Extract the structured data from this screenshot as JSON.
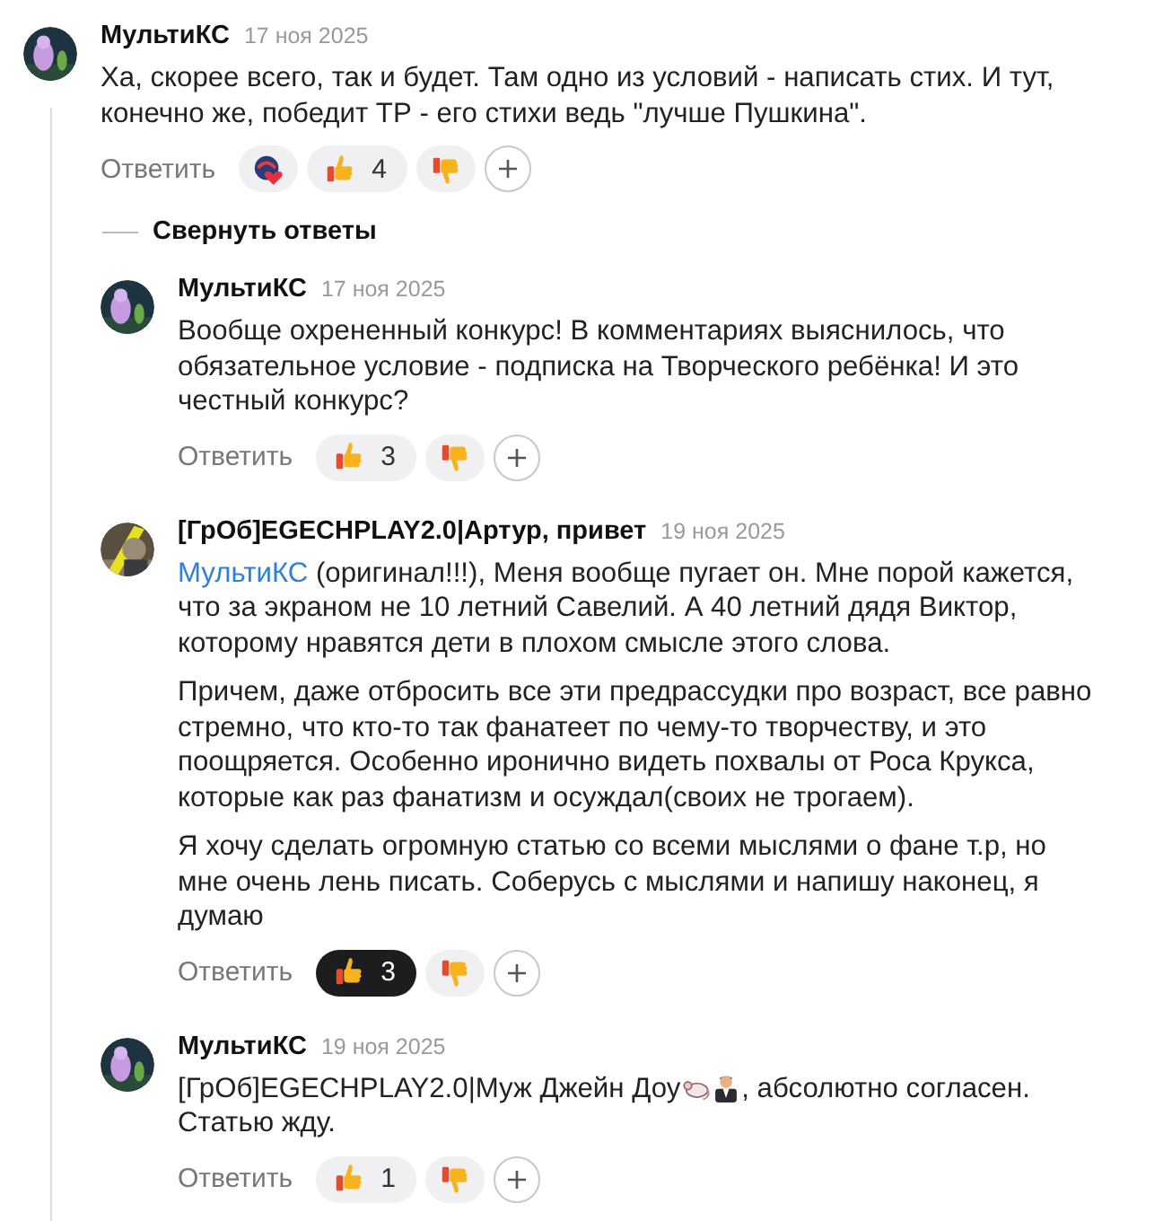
{
  "thread": {
    "comment": {
      "author": "МультиКС",
      "date": "17 ноя 2025",
      "paragraphs": [
        [
          {
            "kind": "text",
            "text": "Ха, скорее всего, так и будет. Там одно из условий - написать стих. И тут, конечно же, победит ТР - его стихи ведь \"лучше Пушкина\"."
          }
        ]
      ],
      "reply_label": "Ответить",
      "reactions": [
        {
          "kind": "custom"
        },
        {
          "kind": "like",
          "count": "4",
          "selected": false
        },
        {
          "kind": "dislike",
          "selected": false
        }
      ]
    },
    "collapse_label": "Свернуть ответы",
    "replies": [
      {
        "author": "МультиКС",
        "date": "17 ноя 2025",
        "paragraphs": [
          [
            {
              "kind": "text",
              "text": "Вообще охрененный конкурс! В комментариях выяснилось, что обязательное условие - подписка на Творческого ребёнка! И это честный конкурс?"
            }
          ]
        ],
        "reply_label": "Ответить",
        "reactions": [
          {
            "kind": "like",
            "count": "3",
            "selected": false
          },
          {
            "kind": "dislike",
            "selected": false
          }
        ]
      },
      {
        "author": "[ГрОб]EGECHPLAY2.0|Артур, привет",
        "date": "19 ноя 2025",
        "paragraphs": [
          [
            {
              "kind": "mention",
              "text": "МультиКС"
            },
            {
              "kind": "text",
              "text": " (оригинал!!!), Меня вообще пугает он. Мне порой кажется, что за экраном не 10 летний Савелий. А 40 летний дядя Виктор, которому нравятся дети в плохом смысле этого слова."
            }
          ],
          [
            {
              "kind": "text",
              "text": "Причем, даже отбросить все эти предрассудки про возраст, все равно стремно, что кто-то так фанатеет по чему-то творчеству, и это поощряется. Особенно иронично видеть похвалы от Роса Крукса, которые как раз фанатизм и осуждал(своих не трогаем)."
            }
          ],
          [
            {
              "kind": "text",
              "text": "Я хочу сделать огромную статью со всеми мыслями о фане т.р, но мне очень лень писать. Соберусь с мыслями и напишу наконец, я думаю"
            }
          ]
        ],
        "reply_label": "Ответить",
        "reactions": [
          {
            "kind": "like",
            "count": "3",
            "selected": true
          },
          {
            "kind": "dislike",
            "selected": false
          }
        ]
      },
      {
        "author": "МультиКС",
        "date": "19 ноя 2025",
        "paragraphs": [
          [
            {
              "kind": "text",
              "text": "[ГрОб]EGECHPLAY2.0|Муж Джейн Доу"
            },
            {
              "kind": "emoji"
            },
            {
              "kind": "emoji"
            },
            {
              "kind": "text",
              "text": ", абсолютно согласен. Статью жду."
            }
          ]
        ],
        "reply_label": "Ответить",
        "reactions": [
          {
            "kind": "like",
            "count": "1",
            "selected": false
          },
          {
            "kind": "dislike",
            "selected": false
          }
        ]
      }
    ]
  }
}
